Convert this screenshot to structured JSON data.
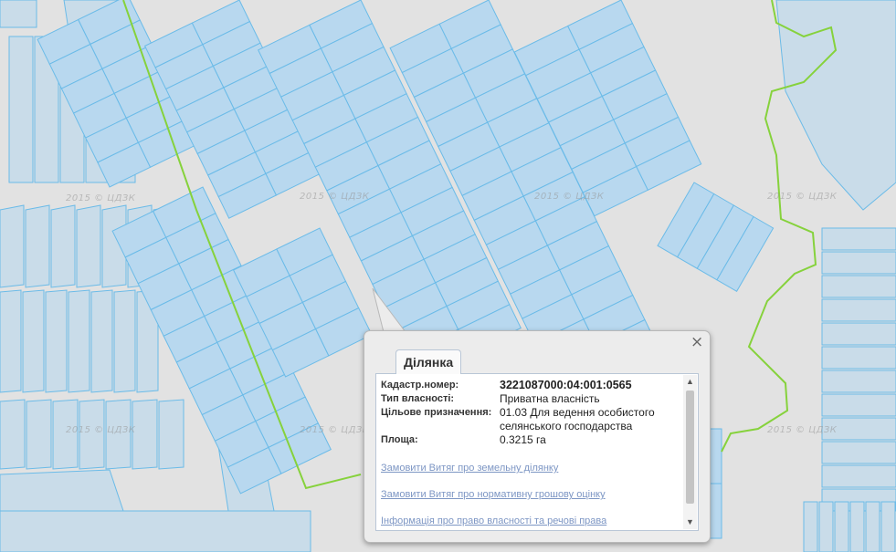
{
  "map": {
    "watermark": "2015 © ЦДЗК",
    "colors": {
      "background": "#e2e2e2",
      "road": "#e7e7e7",
      "parcel_fill": "#b8d8ef",
      "parcel_fill_dark": "#a7cdea",
      "parcel_fill_pale": "#c9dce9",
      "parcel_stroke": "#6bbbe8",
      "boundary_line": "#86d23c"
    }
  },
  "popup": {
    "tab_label": "Ділянка",
    "close_icon": "close-icon",
    "fields": [
      {
        "label": "Кадастр.номер:",
        "value": "3221087000:04:001:0565"
      },
      {
        "label": "Тип власності:",
        "value": "Приватна власність"
      },
      {
        "label": "Цільове призначення:",
        "value": "01.03 Для ведення особистого селянського господарства"
      },
      {
        "label": "Площа:",
        "value": "0.3215 га"
      }
    ],
    "links": [
      "Замовити Витяг про земельну ділянку",
      "Замовити Витяг про нормативну грошову оцінку",
      "Інформація про право власності та речові права"
    ]
  }
}
